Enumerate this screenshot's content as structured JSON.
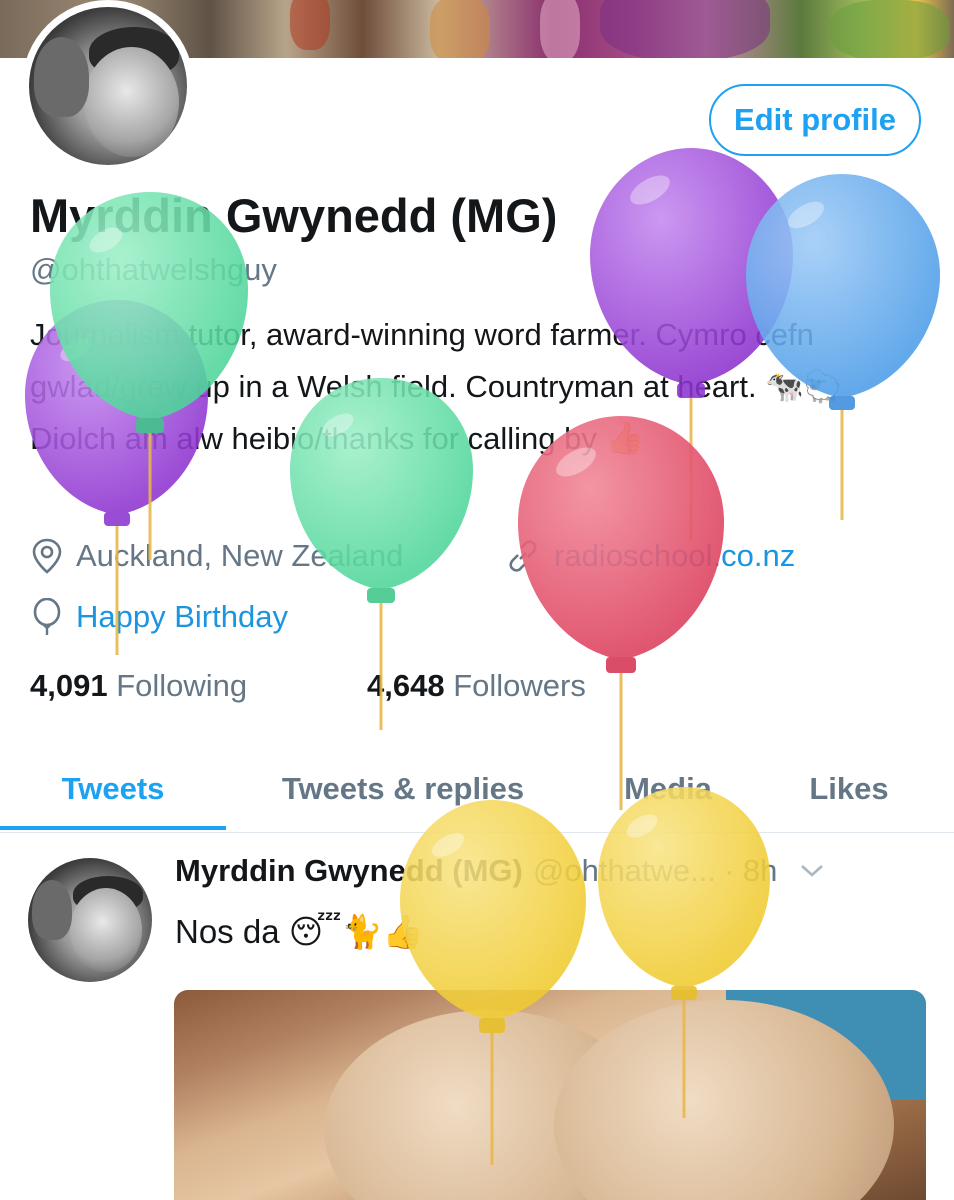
{
  "profile": {
    "edit_button": "Edit profile",
    "name": "Myrddin Gwynedd (MG)",
    "handle": "@ohthatwelshguy",
    "bio": "Journalism tutor, award-winning word farmer. Cymro cefn gwlad/grew up in a Welsh field. Countryman at heart. 🐄🐑 Diolch am alw heibio/thanks for calling by 👍",
    "location": "Auckland, New Zealand",
    "website": "radioschool.co.nz",
    "birthday": "Happy Birthday",
    "following_count": "4,091",
    "following_label": "Following",
    "followers_count": "4,648",
    "followers_label": "Followers"
  },
  "tabs": [
    {
      "label": "Tweets",
      "active": true
    },
    {
      "label": "Tweets & replies",
      "active": false
    },
    {
      "label": "Media",
      "active": false
    },
    {
      "label": "Likes",
      "active": false
    }
  ],
  "tweet": {
    "author_name": "Myrddin Gwynedd (MG)",
    "author_handle": "@ohthatwe...",
    "time": "· 8h",
    "text": "Nos da 😴🐈👍"
  },
  "icons": {
    "location": "location-pin-icon",
    "link": "link-icon",
    "birthday": "balloon-icon",
    "caret": "chevron-down-icon"
  },
  "colors": {
    "accent": "#1da1f2",
    "link": "#1b95e0",
    "secondary_text": "#657786",
    "balloon_purple": "#9b3fd6",
    "balloon_green": "#5fe0a6",
    "balloon_blue": "#57a6f0",
    "balloon_red": "#e5566e",
    "balloon_yellow": "#f5d341"
  }
}
